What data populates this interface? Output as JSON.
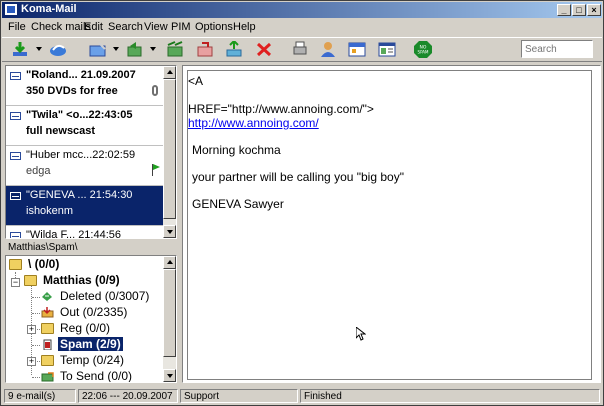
{
  "window": {
    "title": "Koma-Mail"
  },
  "menu": [
    "File",
    "Check mails",
    "Edit",
    "Search",
    "View",
    "PIM",
    "Options",
    "Help"
  ],
  "toolbar": {
    "search_placeholder": "Search"
  },
  "mail_list": [
    {
      "line1": "\"Roland... 21.09.2007",
      "line2": "350 DVDs for free",
      "bold": true,
      "selected": false,
      "attachment": true,
      "flag": false
    },
    {
      "line1": "\"Twila\" <o...22:43:05",
      "line2": "full newscast",
      "bold": true,
      "selected": false,
      "attachment": false,
      "flag": false
    },
    {
      "line1": "\"Huber mcc...22:02:59",
      "line2": "edga",
      "bold": false,
      "selected": false,
      "attachment": false,
      "flag": true
    },
    {
      "line1": "\"GENEVA ... 21:54:30",
      "line2": "ishokenm",
      "bold": false,
      "selected": true,
      "attachment": false,
      "flag": false
    },
    {
      "line1": "\"Wilda F... 21:44:56",
      "line2": "",
      "bold": false,
      "selected": false,
      "attachment": false,
      "flag": false
    }
  ],
  "folder_path": "Matthias\\Spam\\",
  "tree": {
    "root": "\\ (0/0)",
    "account": "Matthias (0/9)",
    "folders": [
      {
        "label": "Deleted (0/3007)"
      },
      {
        "label": "Out (0/2335)"
      },
      {
        "label": "Reg (0/0)"
      },
      {
        "label": "Spam (2/9)"
      },
      {
        "label": "Temp (0/24)"
      },
      {
        "label": "To Send (0/0)"
      }
    ]
  },
  "message": {
    "tag_open": "<A",
    "href_line": "HREF=\"http://www.annoing.com/\">",
    "link": "http://www.annoing.com/",
    "greeting": "Morning kochma",
    "body": "your partner will be calling you \"big boy\"",
    "signature": "GENEVA Sawyer"
  },
  "status": {
    "count": "9 e-mail(s)",
    "time": "22:06 --- 20.09.2007",
    "support": "Support",
    "state": "Finished"
  },
  "colors": {
    "selection": "#0a246a",
    "link": "#0000ee",
    "chrome": "#d4d0c8"
  }
}
